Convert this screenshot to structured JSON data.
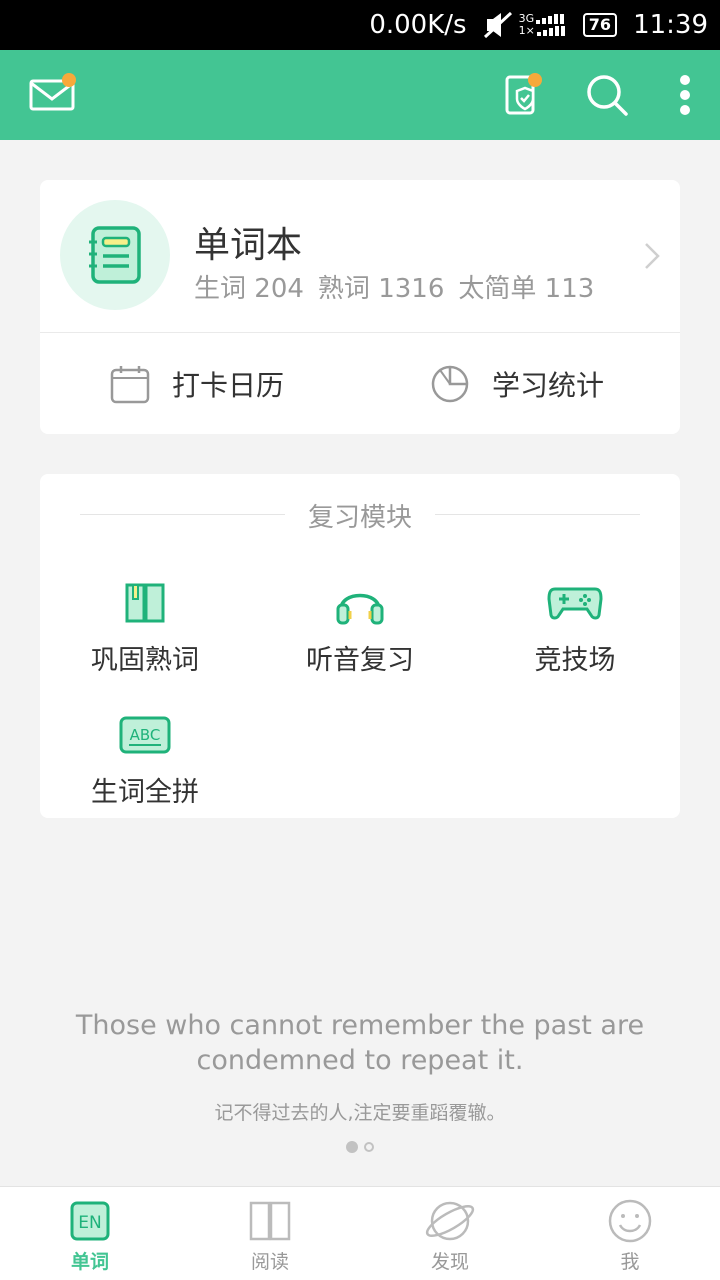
{
  "status_bar": {
    "net_speed": "0.00K/s",
    "network": "3G",
    "sim2": "1×",
    "battery": "76",
    "time": "11:39"
  },
  "app_bar": {
    "icons": [
      "mail-icon",
      "checkin-shield-icon",
      "search-icon",
      "more-icon"
    ],
    "accent": "#43c593",
    "badge_color": "#f7a93b"
  },
  "wordbook": {
    "title": "单词本",
    "stats": [
      {
        "label": "生词",
        "value": "204"
      },
      {
        "label": "熟词",
        "value": "1316"
      },
      {
        "label": "太简单",
        "value": "113"
      }
    ],
    "quick": [
      {
        "label": "打卡日历",
        "icon": "calendar-icon"
      },
      {
        "label": "学习统计",
        "icon": "pie-chart-icon"
      }
    ]
  },
  "review": {
    "title": "复习模块",
    "modules": [
      {
        "label": "巩固熟词",
        "icon": "book-icon"
      },
      {
        "label": "听音复习",
        "icon": "headphones-icon"
      },
      {
        "label": "竞技场",
        "icon": "gamepad-icon"
      },
      {
        "label": "生词全拼",
        "icon": "abc-icon"
      }
    ]
  },
  "quote": {
    "en_line1": "Those who cannot remember the past are",
    "en_line2": "condemned to repeat it.",
    "cn": "记不得过去的人,注定要重蹈覆辙。"
  },
  "bottom_nav": [
    {
      "label": "单词",
      "icon": "en-word-icon",
      "active": true
    },
    {
      "label": "阅读",
      "icon": "reading-book-icon",
      "active": false
    },
    {
      "label": "发现",
      "icon": "planet-icon",
      "active": false
    },
    {
      "label": "我",
      "icon": "smiley-icon",
      "active": false
    }
  ],
  "icon_text": {
    "en": "EN",
    "abc": "ABC"
  }
}
